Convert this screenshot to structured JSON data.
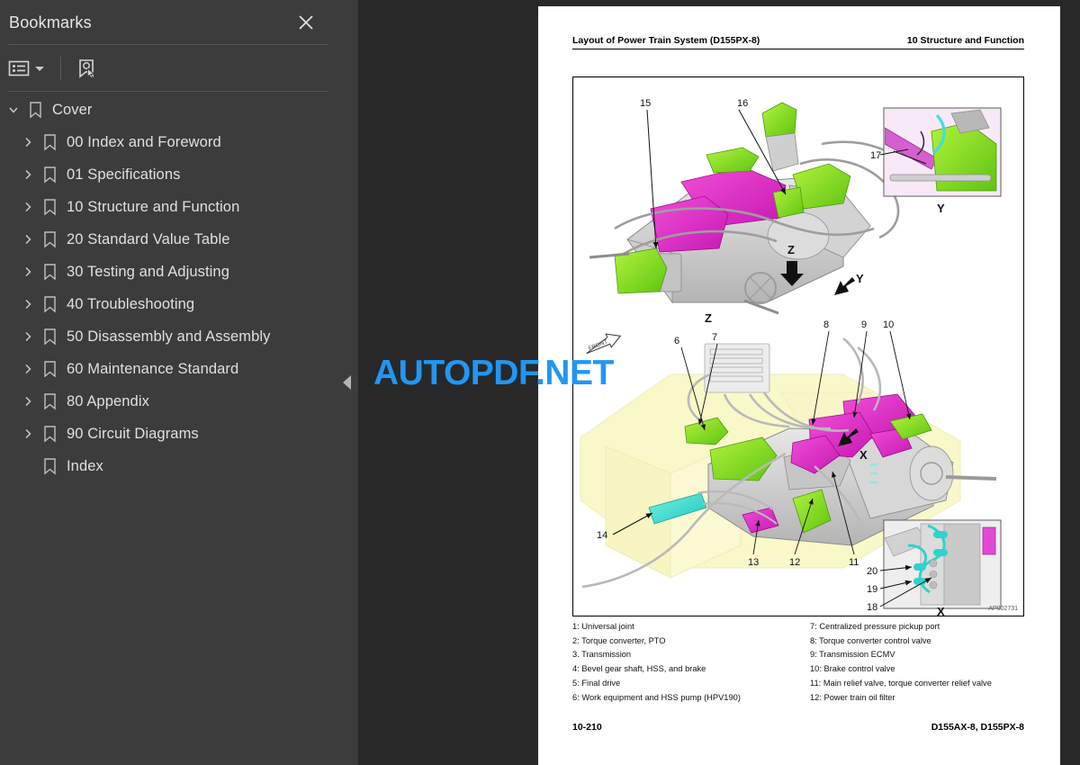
{
  "sidebar": {
    "title": "Bookmarks",
    "close_icon": "close-icon",
    "toolbar": {
      "options_icon": "list-options-icon",
      "caret_icon": "chevron-down-icon",
      "new_bookmark_icon": "bookmark-pointer-icon"
    },
    "items": [
      {
        "label": "Cover",
        "level": 0,
        "expanded": true,
        "has_children": true
      },
      {
        "label": "00 Index and Foreword",
        "level": 1,
        "expanded": false,
        "has_children": true
      },
      {
        "label": "01 Specifications",
        "level": 1,
        "expanded": false,
        "has_children": true
      },
      {
        "label": "10 Structure and Function",
        "level": 1,
        "expanded": false,
        "has_children": true
      },
      {
        "label": "20 Standard Value Table",
        "level": 1,
        "expanded": false,
        "has_children": true
      },
      {
        "label": "30 Testing and Adjusting",
        "level": 1,
        "expanded": false,
        "has_children": true
      },
      {
        "label": "40 Troubleshooting",
        "level": 1,
        "expanded": false,
        "has_children": true
      },
      {
        "label": "50 Disassembly and Assembly",
        "level": 1,
        "expanded": false,
        "has_children": true
      },
      {
        "label": "60 Maintenance Standard",
        "level": 1,
        "expanded": false,
        "has_children": true
      },
      {
        "label": "80 Appendix",
        "level": 1,
        "expanded": false,
        "has_children": true
      },
      {
        "label": "90 Circuit Diagrams",
        "level": 1,
        "expanded": false,
        "has_children": true
      },
      {
        "label": "Index",
        "level": 1,
        "expanded": false,
        "has_children": false
      }
    ]
  },
  "viewer": {
    "collapse_handle_icon": "triangle-left-icon",
    "watermark": "AUTOPDF.NET",
    "watermark_color": "#2196f3"
  },
  "page": {
    "header_left": "Layout of Power Train System (D155PX-8)",
    "header_right": "10 Structure and Function",
    "footer_left": "10-210",
    "footer_right": "D155AX-8, D155PX-8",
    "figure": {
      "id_code": "AP002731",
      "callouts": [
        "6",
        "7",
        "8",
        "9",
        "10",
        "11",
        "12",
        "13",
        "14",
        "15",
        "16",
        "17",
        "18",
        "19",
        "20"
      ],
      "direction_labels": [
        "Z",
        "Y",
        "X"
      ],
      "front_arrow_label": "FRONT",
      "inset_labels": [
        "Y",
        "X"
      ]
    },
    "legend": {
      "left_column": [
        "1: Universal joint",
        "2: Torque converter, PTO",
        "3. Transmission",
        "4: Bevel gear shaft, HSS, and brake",
        "5: Final drive",
        "6: Work equipment and HSS pump (HPV190)"
      ],
      "right_column": [
        "7: Centralized pressure pickup port",
        "8: Torque converter control valve",
        "9: Transmission ECMV",
        "10: Brake control valve",
        "11: Main relief valve, torque converter relief valve",
        "12: Power train oil filter"
      ]
    }
  }
}
